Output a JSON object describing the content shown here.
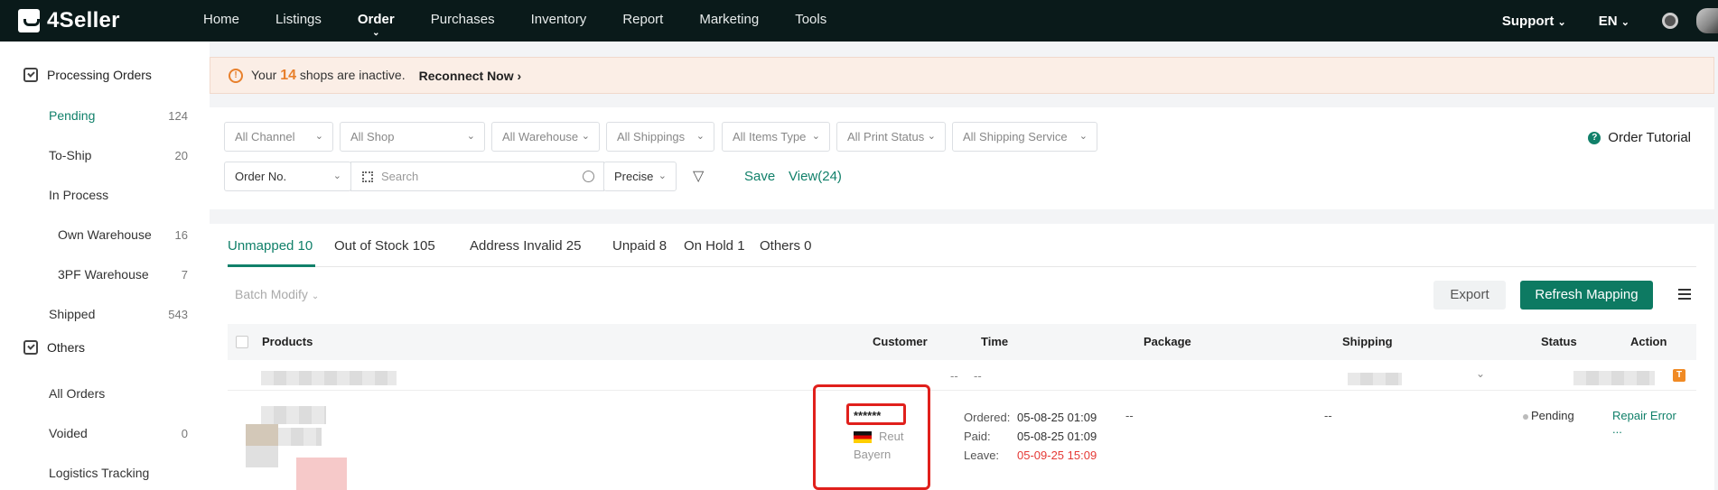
{
  "brand": {
    "name": "4Seller"
  },
  "nav": {
    "items": [
      "Home",
      "Listings",
      "Order",
      "Purchases",
      "Inventory",
      "Report",
      "Marketing",
      "Tools"
    ],
    "active": "Order",
    "support": "Support",
    "language": "EN"
  },
  "sidebar": {
    "processing_title": "Processing Orders",
    "items": [
      {
        "label": "Pending",
        "count": "124"
      },
      {
        "label": "To-Ship",
        "count": "20"
      },
      {
        "label": "In Process",
        "count": ""
      },
      {
        "label": "Own Warehouse",
        "count": "16"
      },
      {
        "label": "3PF Warehouse",
        "count": "7"
      },
      {
        "label": "Shipped",
        "count": "543"
      }
    ],
    "others_title": "Others",
    "others_items": [
      {
        "label": "All Orders",
        "count": ""
      },
      {
        "label": "Voided",
        "count": "0"
      },
      {
        "label": "Logistics Tracking",
        "count": ""
      }
    ]
  },
  "banner": {
    "prefix": "Your",
    "count": "14",
    "suffix": "shops are inactive.",
    "link": "Reconnect Now"
  },
  "filters": {
    "row1": [
      "All Channel",
      "All Shop",
      "All Warehouse",
      "All Shippings",
      "All Items Type",
      "All Print Status",
      "All Shipping Service"
    ],
    "order_no": "Order No.",
    "search_placeholder": "Search",
    "precise": "Precise",
    "save": "Save",
    "view": "View(24)",
    "tutorial": "Order Tutorial"
  },
  "tabs": [
    {
      "label": "Unmapped 10"
    },
    {
      "label": "Out of Stock 105"
    },
    {
      "label": "Address Invalid 25"
    },
    {
      "label": "Unpaid 8"
    },
    {
      "label": "On Hold 1"
    },
    {
      "label": "Others 0"
    }
  ],
  "toolbar": {
    "batch_modify": "Batch Modify",
    "export": "Export",
    "refresh_mapping": "Refresh Mapping"
  },
  "table": {
    "headers": [
      "Products",
      "Customer",
      "Time",
      "Package",
      "Shipping",
      "Status",
      "Action"
    ],
    "subrow": {
      "dash1": "--",
      "dash2": "--"
    },
    "row": {
      "customer_name": "******",
      "customer_city": "Reut",
      "customer_region": "Bayern",
      "ordered_label": "Ordered:",
      "ordered": "05-08-25 01:09",
      "paid_label": "Paid:",
      "paid": "05-08-25 01:09",
      "leave_label": "Leave:",
      "leave": "05-09-25 15:09",
      "package": "--",
      "shipping": "--",
      "status": "Pending",
      "action": "Repair Error",
      "more": "..."
    }
  },
  "colors": {
    "accent": "#11806a",
    "topbar": "#0a1a1a",
    "warning": "#e8802c",
    "highlight": "#e0201c"
  }
}
